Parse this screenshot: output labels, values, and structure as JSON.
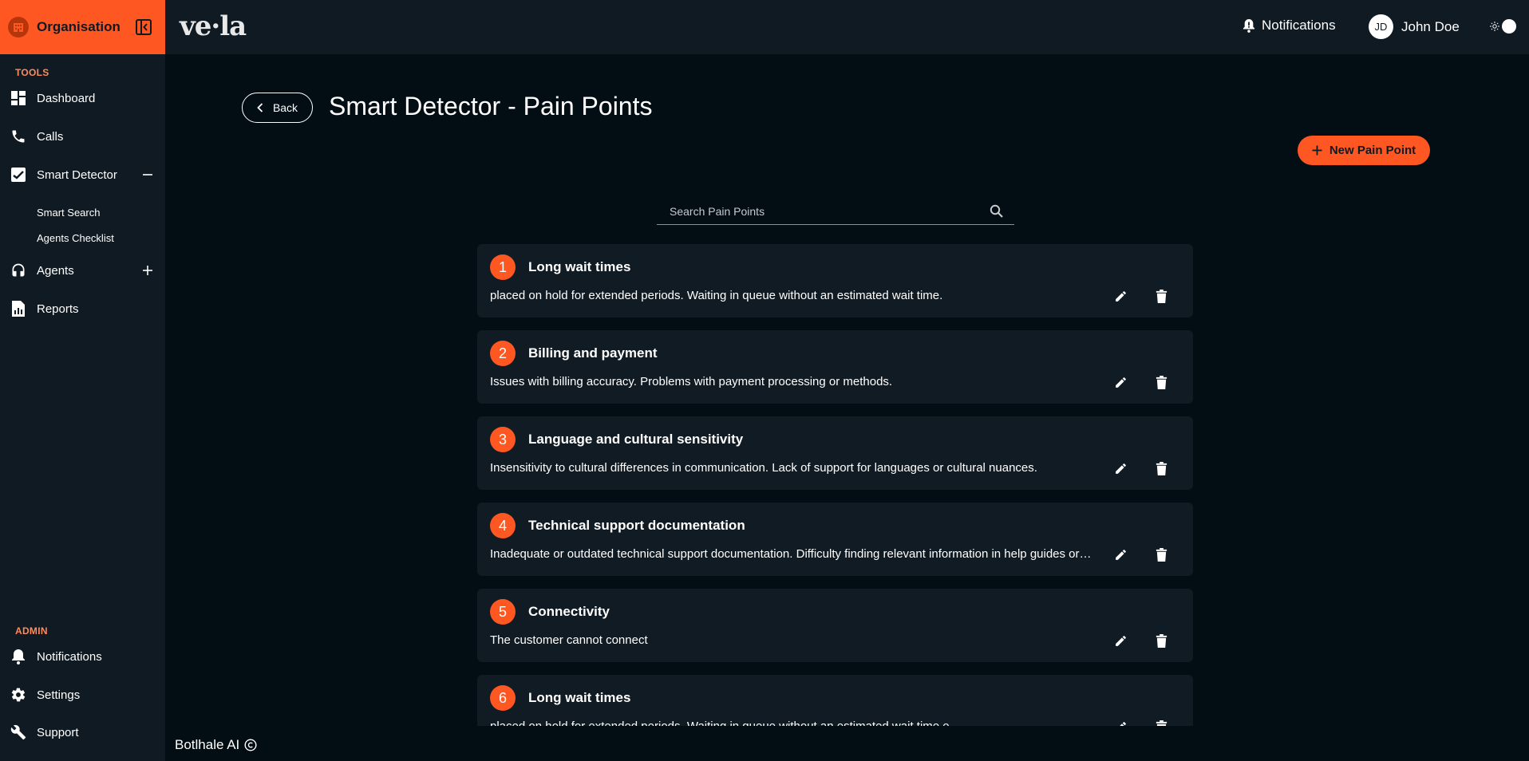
{
  "sidebar": {
    "org_label": "Organisation",
    "tools_title": "TOOLS",
    "admin_title": "ADMIN",
    "items": [
      {
        "label": "Dashboard",
        "icon": "dashboard-icon"
      },
      {
        "label": "Calls",
        "icon": "phone-icon"
      },
      {
        "label": "Smart Detector",
        "icon": "check-chart-icon",
        "expanded": true
      },
      {
        "label": "Agents",
        "icon": "headset-icon"
      },
      {
        "label": "Reports",
        "icon": "report-icon"
      }
    ],
    "sub_items": [
      {
        "label": "Smart Search"
      },
      {
        "label": "Agents Checklist"
      }
    ],
    "admin_items": [
      {
        "label": "Notifications",
        "icon": "bell-icon"
      },
      {
        "label": "Settings",
        "icon": "gear-icon"
      },
      {
        "label": "Support",
        "icon": "wrench-icon"
      }
    ]
  },
  "topbar": {
    "logo_text": "ve·la",
    "notifications_label": "Notifications",
    "user_initials": "JD",
    "user_name": "John Doe",
    "theme_icon": "sun-icon"
  },
  "page": {
    "back_label": "Back",
    "title": "Smart Detector - Pain Points",
    "new_button_label": "New Pain Point",
    "search_placeholder": "Search Pain Points"
  },
  "pain_points": [
    {
      "number": "1",
      "title": "Long wait times",
      "description": "placed on hold for extended periods. Waiting in queue without an estimated wait time."
    },
    {
      "number": "2",
      "title": "Billing and payment",
      "description": "Issues with billing accuracy. Problems with payment processing or methods."
    },
    {
      "number": "3",
      "title": "Language and cultural sensitivity",
      "description": "Insensitivity to cultural differences in communication. Lack of support for languages or cultural nuances."
    },
    {
      "number": "4",
      "title": "Technical support documentation",
      "description": "Inadequate or outdated technical support documentation. Difficulty finding relevant information in help guides or manuals."
    },
    {
      "number": "5",
      "title": "Connectivity",
      "description": "The customer cannot connect"
    },
    {
      "number": "6",
      "title": "Long wait times",
      "description": "placed on hold for extended periods. Waiting in queue without an estimated wait time.e"
    }
  ],
  "footer": {
    "text": "Botlhale AI"
  },
  "colors": {
    "accent": "#fe5722",
    "background": "#030d14",
    "surface": "#101a22",
    "card": "#111b23"
  }
}
